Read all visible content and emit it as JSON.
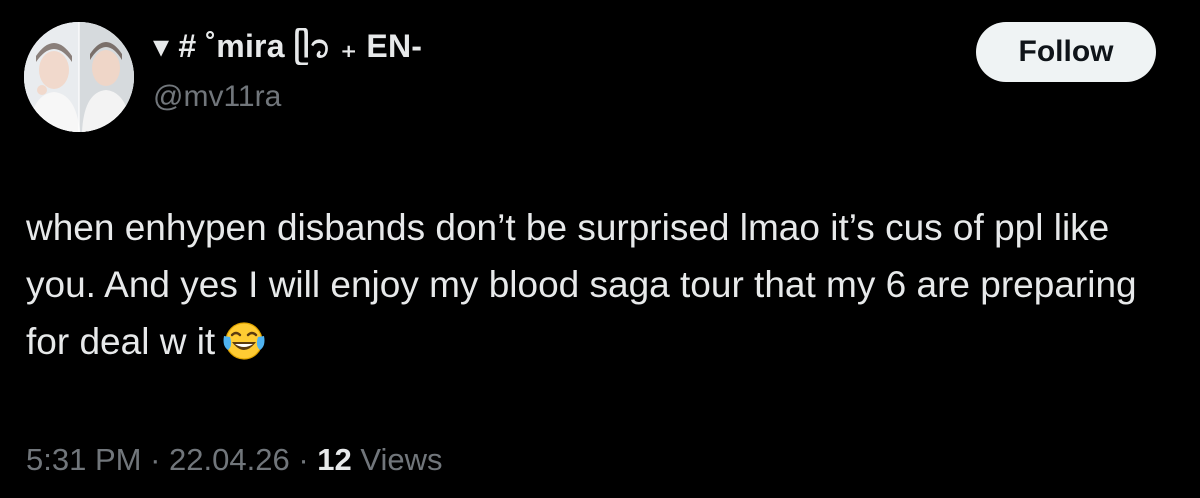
{
  "header": {
    "display_name": "▾ # ˚mira ᥫ᭡ ₊ EN-",
    "handle": "@mv11ra",
    "follow_label": "Follow"
  },
  "tweet": {
    "text": "when enhypen disbands don’t be surprised lmao it’s cus of ppl like you. And yes I will enjoy my blood saga tour that my 6 are preparing for deal w it",
    "emoji": "face-with-tears-of-joy-icon"
  },
  "meta": {
    "time": "5:31 PM",
    "separator": "·",
    "date": "22.04.26",
    "views_count": "12",
    "views_label": "Views"
  },
  "colors": {
    "background": "#000000",
    "primary_text": "#e7e9ea",
    "secondary_text": "#71767b",
    "follow_bg": "#eff3f4",
    "follow_text": "#0f1419"
  }
}
